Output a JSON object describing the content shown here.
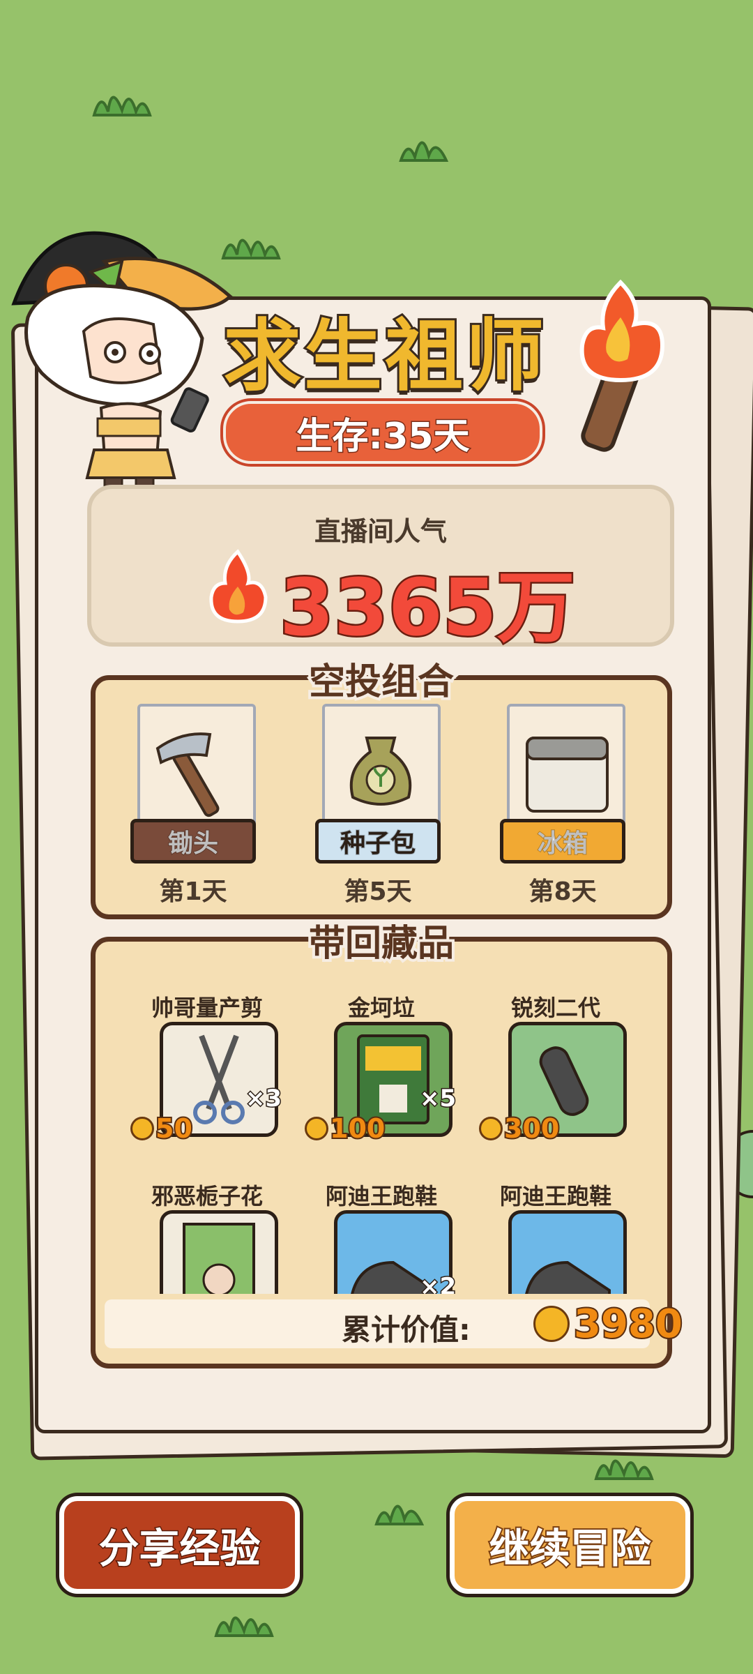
{
  "title": "求生祖师",
  "survival": {
    "text": "生存:35天"
  },
  "popularity": {
    "label": "直播间人气",
    "value": "3365万"
  },
  "airdrop": {
    "title": "空投组合",
    "items": [
      {
        "name": "锄头",
        "day": "第1天",
        "tag_color": "#7a4b3a",
        "text_color": "#ffffff"
      },
      {
        "name": "种子包",
        "day": "第5天",
        "tag_color": "#cfe3f0",
        "text_color": "#3a2a1e"
      },
      {
        "name": "冰箱",
        "day": "第8天",
        "tag_color": "#f1a933",
        "text_color": "#ffffff"
      }
    ]
  },
  "collection": {
    "title": "带回藏品",
    "items": [
      {
        "name": "帅哥量产剪",
        "qty": "×3",
        "price": "50",
        "bg": "#f2ebdd"
      },
      {
        "name": "金坷垃",
        "qty": "×5",
        "price": "100",
        "bg": "#6fa55a"
      },
      {
        "name": "锐刻二代",
        "qty": "",
        "price": "300",
        "bg": "#8fc489"
      },
      {
        "name": "邪恶栀子花",
        "qty": "",
        "price": "",
        "bg": "#f2ebdd"
      },
      {
        "name": "阿迪王跑鞋",
        "qty": "×2",
        "price": "",
        "bg": "#6db8e8"
      },
      {
        "name": "阿迪王跑鞋",
        "qty": "",
        "price": "",
        "bg": "#6db8e8"
      }
    ],
    "total_label": "累计价值:",
    "total_value": "3980"
  },
  "buttons": {
    "share": "分享经验",
    "continue": "继续冒险"
  },
  "colors": {
    "background": "#96c26a",
    "accent_orange": "#e8613a",
    "coin": "#f4b526"
  }
}
